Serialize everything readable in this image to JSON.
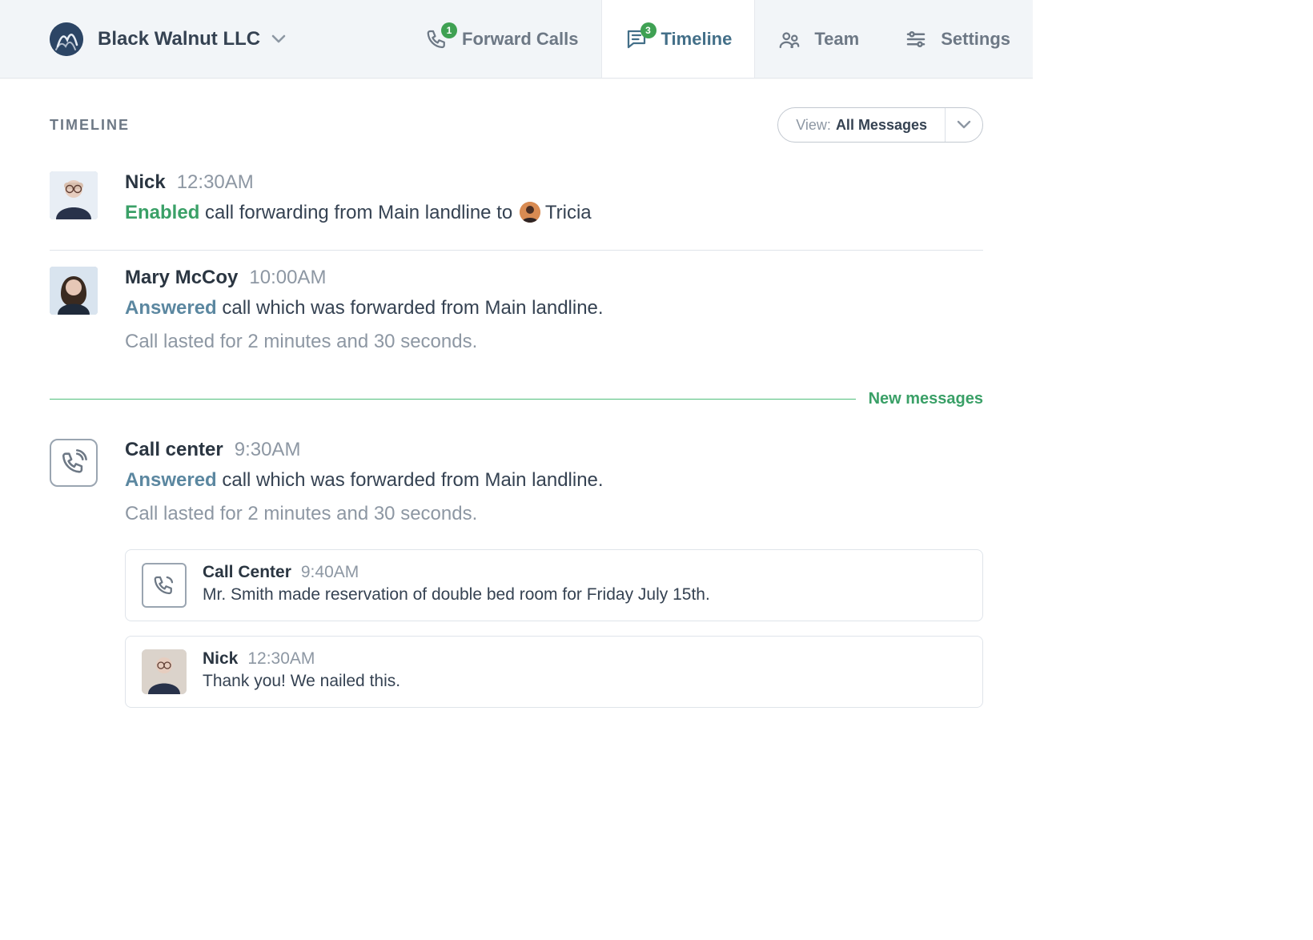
{
  "org": {
    "name": "Black Walnut LLC"
  },
  "nav": {
    "forward_calls": {
      "label": "Forward Calls",
      "badge": "1"
    },
    "timeline": {
      "label": "Timeline",
      "badge": "3"
    },
    "team": {
      "label": "Team"
    },
    "settings": {
      "label": "Settings"
    }
  },
  "section_title": "TIMELINE",
  "view_filter": {
    "prefix": "View: ",
    "value": "All Messages"
  },
  "new_messages_label": "New messages",
  "items": [
    {
      "author": "Nick",
      "time": "12:30AM",
      "status": "Enabled",
      "status_kind": "green",
      "text_after_status": " call forwarding from Main landline to ",
      "mention_name": "Tricia",
      "detail": null
    },
    {
      "author": "Mary McCoy",
      "time": "10:00AM",
      "status": "Answered",
      "status_kind": "blue",
      "text_after_status": " call which was forwarded from Main landline.",
      "detail": "Call lasted for 2 minutes and 30 seconds."
    },
    {
      "author": "Call center",
      "time": "9:30AM",
      "status": "Answered",
      "status_kind": "blue",
      "text_after_status": " call which was forwarded from Main landline.",
      "detail": "Call lasted for 2 minutes and 30 seconds.",
      "sub_cards": [
        {
          "author": "Call Center",
          "time": "9:40AM",
          "msg": "Mr. Smith made reservation of double bed room for Friday July 15th."
        },
        {
          "author": "Nick",
          "time": "12:30AM",
          "msg": "Thank you! We nailed this."
        }
      ]
    }
  ]
}
